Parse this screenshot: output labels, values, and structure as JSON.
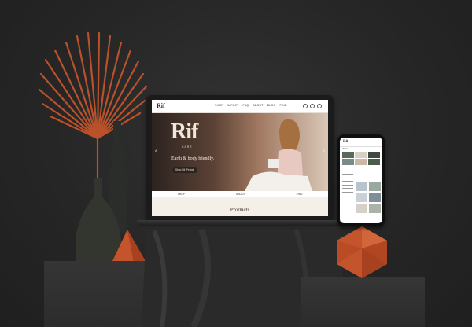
{
  "laptop_site": {
    "logo": "Rif",
    "nav": [
      "SHOP",
      "IMPACT",
      "FAQ",
      "ABOUT",
      "BLOG",
      "FIND"
    ],
    "hero": {
      "logo": "Rif",
      "subtitle": "CARE",
      "tagline": "Earth & body friendly.",
      "button": "Shop Rif. Period."
    },
    "subnav": [
      "SHOP",
      "ABOUT",
      "FIND"
    ],
    "section_title": "Products",
    "prev_arrow": "‹",
    "next_arrow": "›"
  },
  "phone_site": {
    "logo": "Rif",
    "profile_text": "rifcare"
  },
  "colors": {
    "accent_terracotta": "#c4542b",
    "background": "#262626",
    "site_cream": "#f4efe8",
    "button_dark": "#2b2320"
  }
}
